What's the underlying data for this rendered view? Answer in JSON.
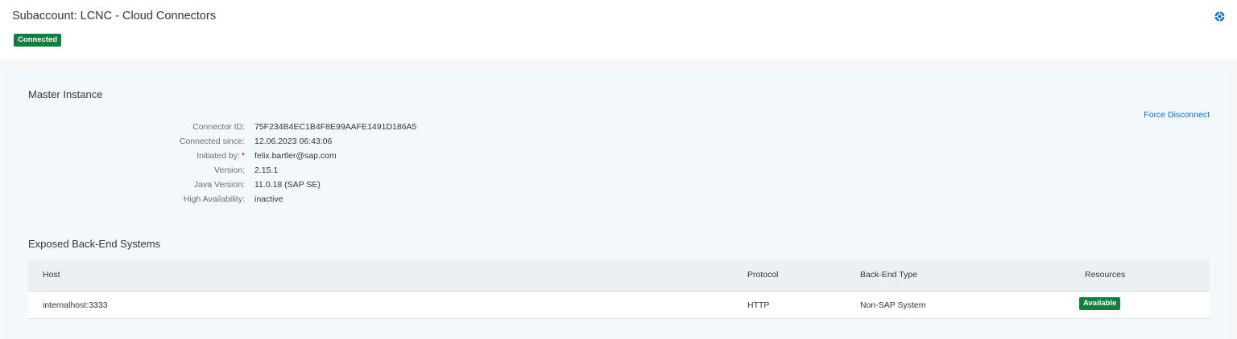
{
  "header": {
    "title": "Subaccount: LCNC - Cloud Connectors",
    "status": "Connected"
  },
  "master_instance": {
    "title": "Master Instance",
    "force_disconnect_label": "Force Disconnect",
    "details": [
      {
        "label": "Connector ID:",
        "value": "75F234B4EC1B4F8E99AAFE1491D186A5"
      },
      {
        "label": "Connected since:",
        "value": "12.06.2023 06:43:06"
      },
      {
        "label": "Initiated by:",
        "value": "felix.bartler@sap.com"
      },
      {
        "label": "Version:",
        "value": "2.15.1"
      },
      {
        "label": "Java Version:",
        "value": "11.0.18 (SAP SE)"
      },
      {
        "label": "High Availability:",
        "value": "inactive"
      }
    ],
    "required_marker": "*"
  },
  "backend_systems": {
    "title": "Exposed Back-End Systems",
    "columns": {
      "host": "Host",
      "protocol": "Protocol",
      "backend_type": "Back-End Type",
      "resources": "Resources"
    },
    "rows": [
      {
        "host": "internalhost:3333",
        "protocol": "HTTP",
        "backend_type": "Non-SAP System",
        "resources": "Available"
      }
    ]
  },
  "colors": {
    "success": "#107e3e",
    "link": "#0a6ed1",
    "required": "#bb0000"
  },
  "icons": {
    "help": "help-icon"
  }
}
